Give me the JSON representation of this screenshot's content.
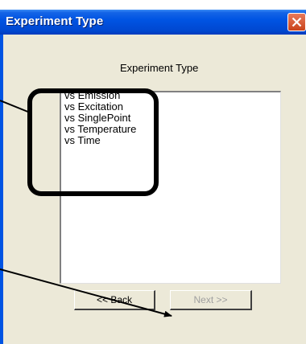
{
  "window": {
    "title": "Experiment Type"
  },
  "heading": "Experiment Type",
  "list": {
    "items": [
      "vs Emission",
      "vs Excitation",
      "vs SinglePoint",
      "vs Temperature",
      "vs Time"
    ]
  },
  "buttons": {
    "back_label": "<< Back",
    "next_label": "Next >>"
  },
  "colors": {
    "titlebar": "#0054e3",
    "client": "#ece9d8",
    "close": "#d9532d",
    "annotation": "#000000"
  },
  "icons": {
    "close": "close-icon"
  }
}
